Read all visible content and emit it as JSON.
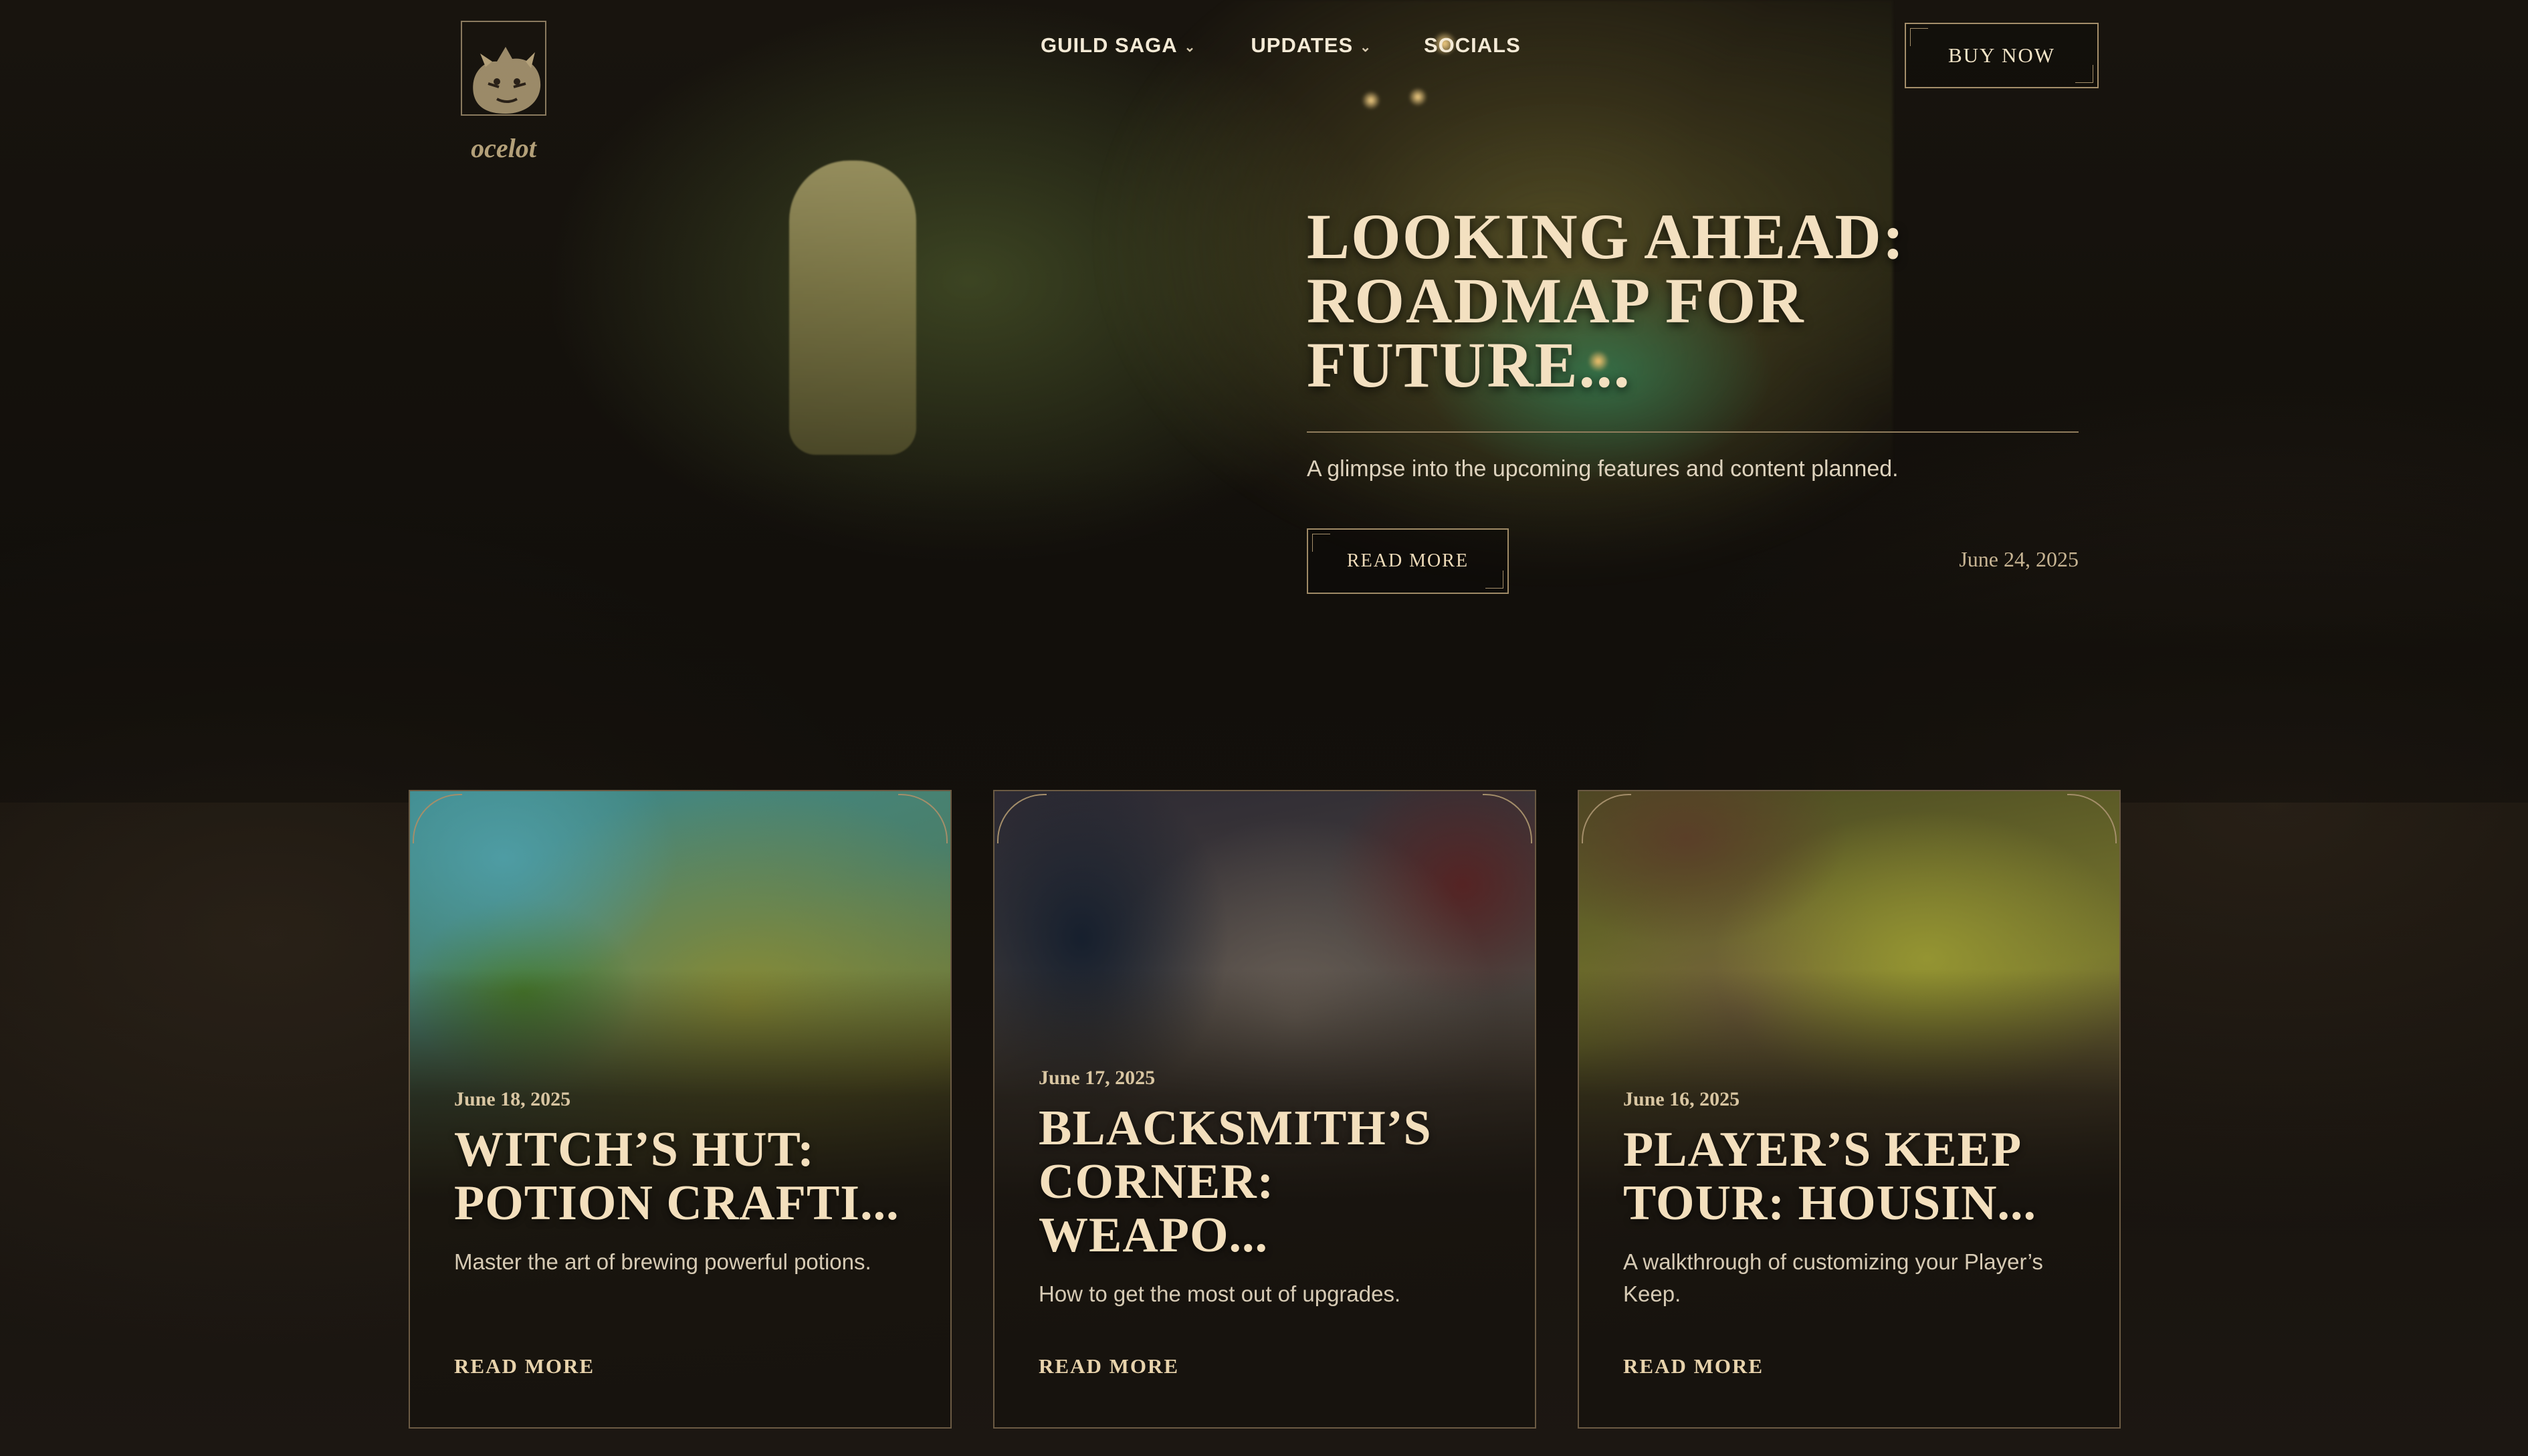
{
  "brand": {
    "logo_text": "OCELOT"
  },
  "nav": {
    "items": [
      {
        "label": "GUILD SAGA",
        "has_dropdown": true
      },
      {
        "label": "UPDATES",
        "has_dropdown": true
      },
      {
        "label": "SOCIALS",
        "has_dropdown": false
      }
    ],
    "buy_label": "BUY NOW"
  },
  "hero": {
    "title": "LOOKING AHEAD: ROADMAP FOR FUTURE...",
    "description": "A glimpse into the upcoming features and content planned.",
    "read_more": "READ MORE",
    "date": "June 24, 2025"
  },
  "cards": [
    {
      "date": "June 18, 2025",
      "title": "WITCH’S HUT: POTION CRAFTI...",
      "description": "Master the art of brewing powerful potions.",
      "link": "READ MORE"
    },
    {
      "date": "June 17, 2025",
      "title": "BLACKSMITH’S CORNER: WEAPO...",
      "description": "How to get the most out of upgrades.",
      "link": "READ MORE"
    },
    {
      "date": "June 16, 2025",
      "title": "PLAYER’S KEEP TOUR: HOUSIN...",
      "description": "A walkthrough of customizing your Player’s Keep.",
      "link": "READ MORE"
    }
  ],
  "colors": {
    "background": "#120f0b",
    "accent_gold": "#a48e6a",
    "title_cream": "#f3e0c0"
  }
}
